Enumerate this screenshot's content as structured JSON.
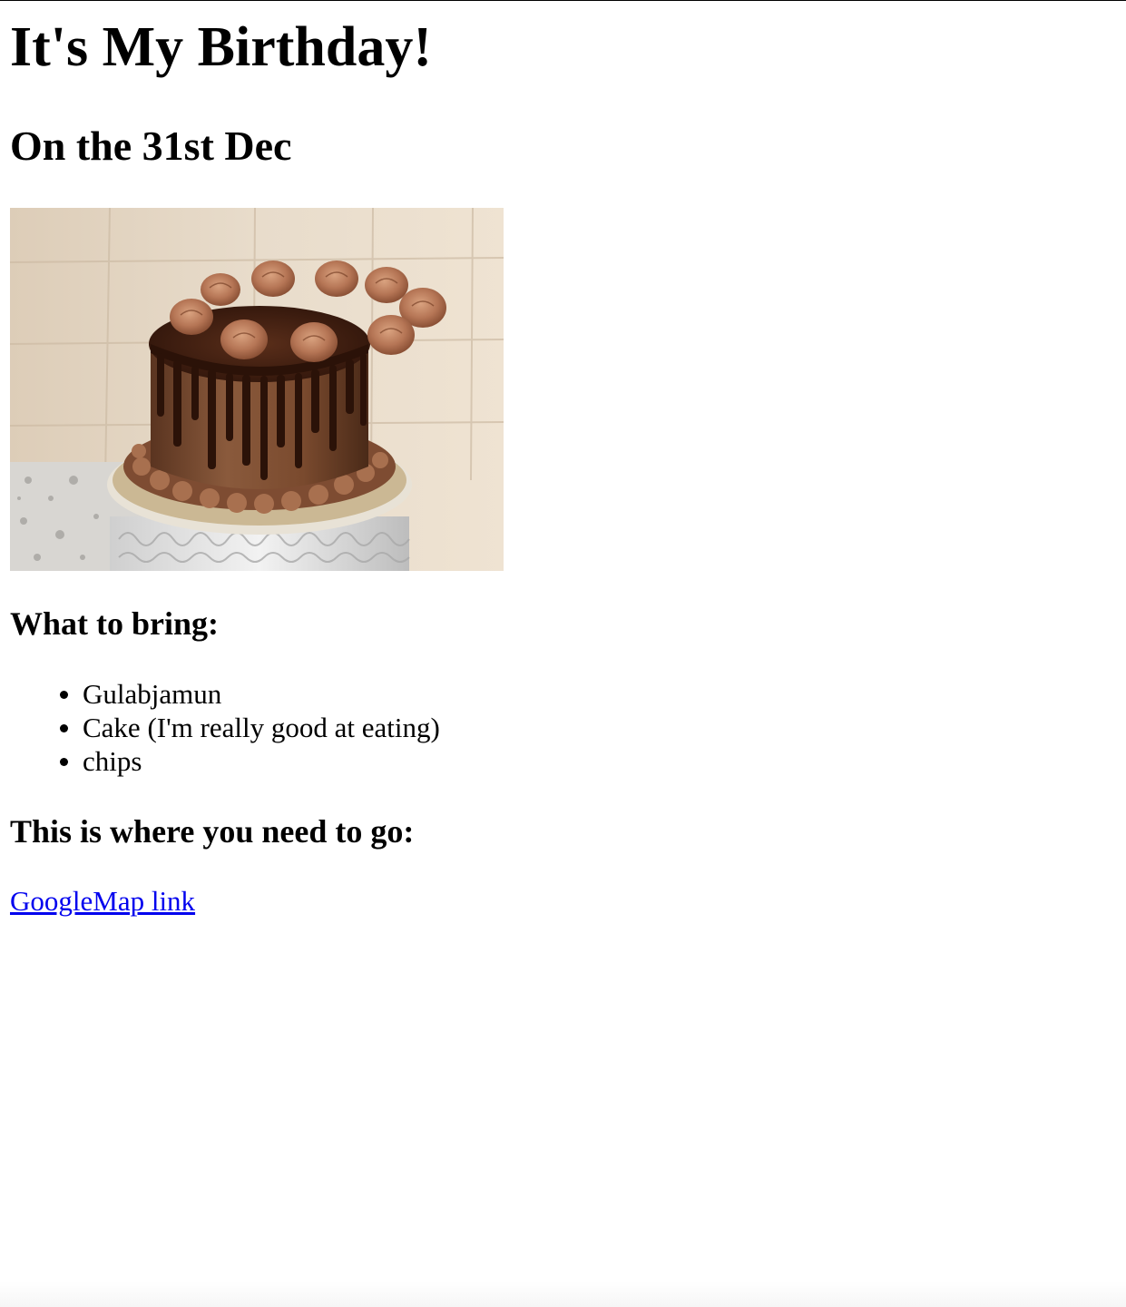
{
  "page": {
    "title": "It's My Birthday!",
    "subtitle": "On the 31st Dec",
    "image_name": "chocolate-cake-image",
    "bring_heading": "What to bring:",
    "bring_items": [
      "Gulabjamun",
      "Cake (I'm really good at eating)",
      "chips"
    ],
    "where_heading": "This is where you need to go:",
    "map_link_text": "GoogleMap link"
  },
  "colors": {
    "text": "#000000",
    "link": "#0000ee",
    "background": "#ffffff"
  }
}
